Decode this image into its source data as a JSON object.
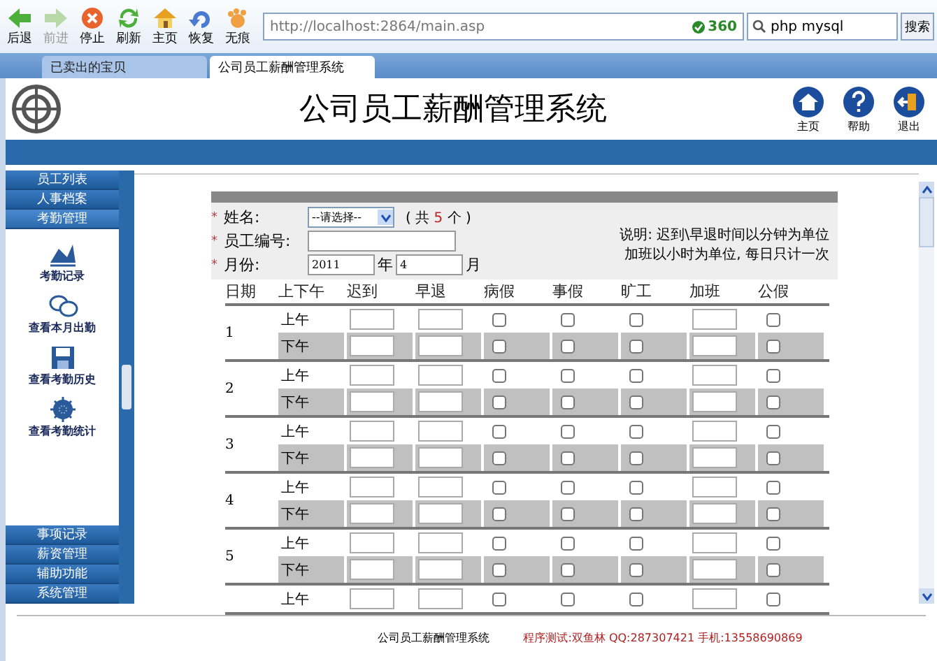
{
  "browser": {
    "toolbar": [
      {
        "kind": "back",
        "label": "后退",
        "disabled": false
      },
      {
        "kind": "forward",
        "label": "前进",
        "disabled": true
      },
      {
        "kind": "stop",
        "label": "停止",
        "disabled": false
      },
      {
        "kind": "refresh",
        "label": "刷新",
        "disabled": false
      },
      {
        "kind": "home",
        "label": "主页",
        "disabled": false
      },
      {
        "kind": "restore",
        "label": "恢复",
        "disabled": false
      },
      {
        "kind": "incognito",
        "label": "无痕",
        "disabled": false
      }
    ],
    "url": "http://localhost:2864/main.asp",
    "url_badge": "360",
    "search": "php mysql",
    "search_button": "搜索",
    "tabs": [
      {
        "label": "已卖出的宝贝",
        "selected": false
      },
      {
        "label": "公司员工薪酬管理系统",
        "selected": true
      }
    ]
  },
  "header": {
    "title": "公司员工薪酬管理系统",
    "actions": [
      {
        "kind": "home",
        "label": "主页"
      },
      {
        "kind": "help",
        "label": "帮助"
      },
      {
        "kind": "exit",
        "label": "退出"
      }
    ]
  },
  "sidebar": {
    "top": [
      {
        "label": "员工列表",
        "expanded": false
      },
      {
        "label": "人事档案",
        "expanded": false
      },
      {
        "label": "考勤管理",
        "expanded": true
      }
    ],
    "items": [
      {
        "kind": "record",
        "label": "考勤记录"
      },
      {
        "kind": "month",
        "label": "查看本月出勤"
      },
      {
        "kind": "history",
        "label": "查看考勤历史"
      },
      {
        "kind": "stats",
        "label": "查看考勤统计"
      }
    ],
    "bottom": [
      {
        "label": "事项记录",
        "expanded": false
      },
      {
        "label": "薪资管理",
        "expanded": false
      },
      {
        "label": "辅助功能",
        "expanded": false
      },
      {
        "label": "系统管理",
        "expanded": false
      }
    ]
  },
  "form": {
    "required_marks": [
      "*",
      "*",
      "*"
    ],
    "name_label": "姓名:",
    "select": "--请选择--",
    "count_prefix": "( 共",
    "count": "5",
    "count_suffix": "个 )",
    "id_label": "员工编号:",
    "month_label": "月份:",
    "year": "2011",
    "year_unit": "年",
    "month": "4",
    "month_unit": "月",
    "note_lines": [
      "说明: 迟到\\早退时间以分钟为单位",
      "加班以小时为单位, 每日只计一次"
    ]
  },
  "table": {
    "columns": [
      "日期",
      "上下午",
      "迟到",
      "早退",
      "病假",
      "事假",
      "旷工",
      "加班",
      "公假"
    ],
    "days": [
      {
        "day": "1",
        "halves": [
          {
            "label": "上午",
            "checks": [
              false,
              false,
              false,
              false
            ]
          },
          {
            "label": "下午",
            "checks": [
              false,
              false,
              false,
              false
            ]
          }
        ]
      },
      {
        "day": "2",
        "halves": [
          {
            "label": "上午",
            "checks": [
              false,
              false,
              false,
              false
            ]
          },
          {
            "label": "下午",
            "checks": [
              false,
              false,
              false,
              false
            ]
          }
        ]
      },
      {
        "day": "3",
        "halves": [
          {
            "label": "上午",
            "checks": [
              false,
              false,
              false,
              false
            ]
          },
          {
            "label": "下午",
            "checks": [
              false,
              false,
              false,
              false
            ]
          }
        ]
      },
      {
        "day": "4",
        "halves": [
          {
            "label": "上午",
            "checks": [
              false,
              false,
              false,
              false
            ]
          },
          {
            "label": "下午",
            "checks": [
              false,
              false,
              false,
              false
            ]
          }
        ]
      },
      {
        "day": "5",
        "halves": [
          {
            "label": "上午",
            "checks": [
              false,
              false,
              false,
              false
            ]
          },
          {
            "label": "下午",
            "checks": [
              false,
              false,
              false,
              false
            ]
          }
        ]
      },
      {
        "halves": [
          {
            "label": "上午",
            "checks": [
              false,
              false,
              false,
              false
            ]
          }
        ]
      }
    ]
  },
  "footer": {
    "title": "公司员工薪酬管理系统",
    "credit": "程序测试:双鱼林 QQ:287307421 手机:13558690869"
  }
}
